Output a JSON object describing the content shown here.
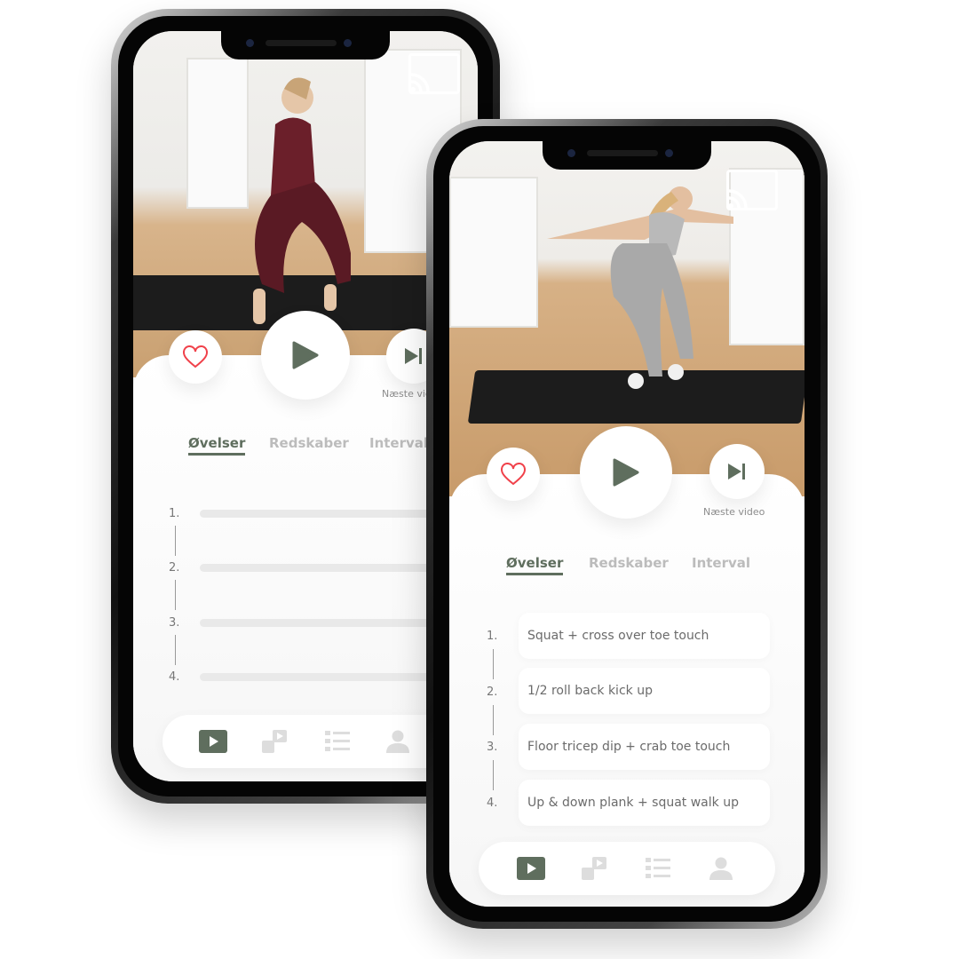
{
  "colors": {
    "accent": "#5f6e5e",
    "heart": "#f0414a",
    "inactive": "#bcbcbc"
  },
  "icons": {
    "cast": "cast-icon",
    "favorite": "heart-icon",
    "play": "play-icon",
    "next": "skip-next-icon",
    "nav": [
      "video-play-icon",
      "videos-icon",
      "list-icon",
      "profile-icon"
    ]
  },
  "back_phone": {
    "next_label": "Næste vid",
    "tabs": [
      "Øvelser",
      "Redskaber",
      "Interval"
    ],
    "list_numbers": [
      "1.",
      "2.",
      "3.",
      "4."
    ]
  },
  "front_phone": {
    "next_label": "Næste video",
    "tabs": [
      "Øvelser",
      "Redskaber",
      "Interval"
    ],
    "exercises": [
      {
        "num": "1.",
        "name": "Squat + cross over toe touch"
      },
      {
        "num": "2.",
        "name": "1/2 roll back kick up"
      },
      {
        "num": "3.",
        "name": "Floor tricep dip + crab toe touch"
      },
      {
        "num": "4.",
        "name": "Up & down plank  + squat walk up"
      }
    ]
  }
}
